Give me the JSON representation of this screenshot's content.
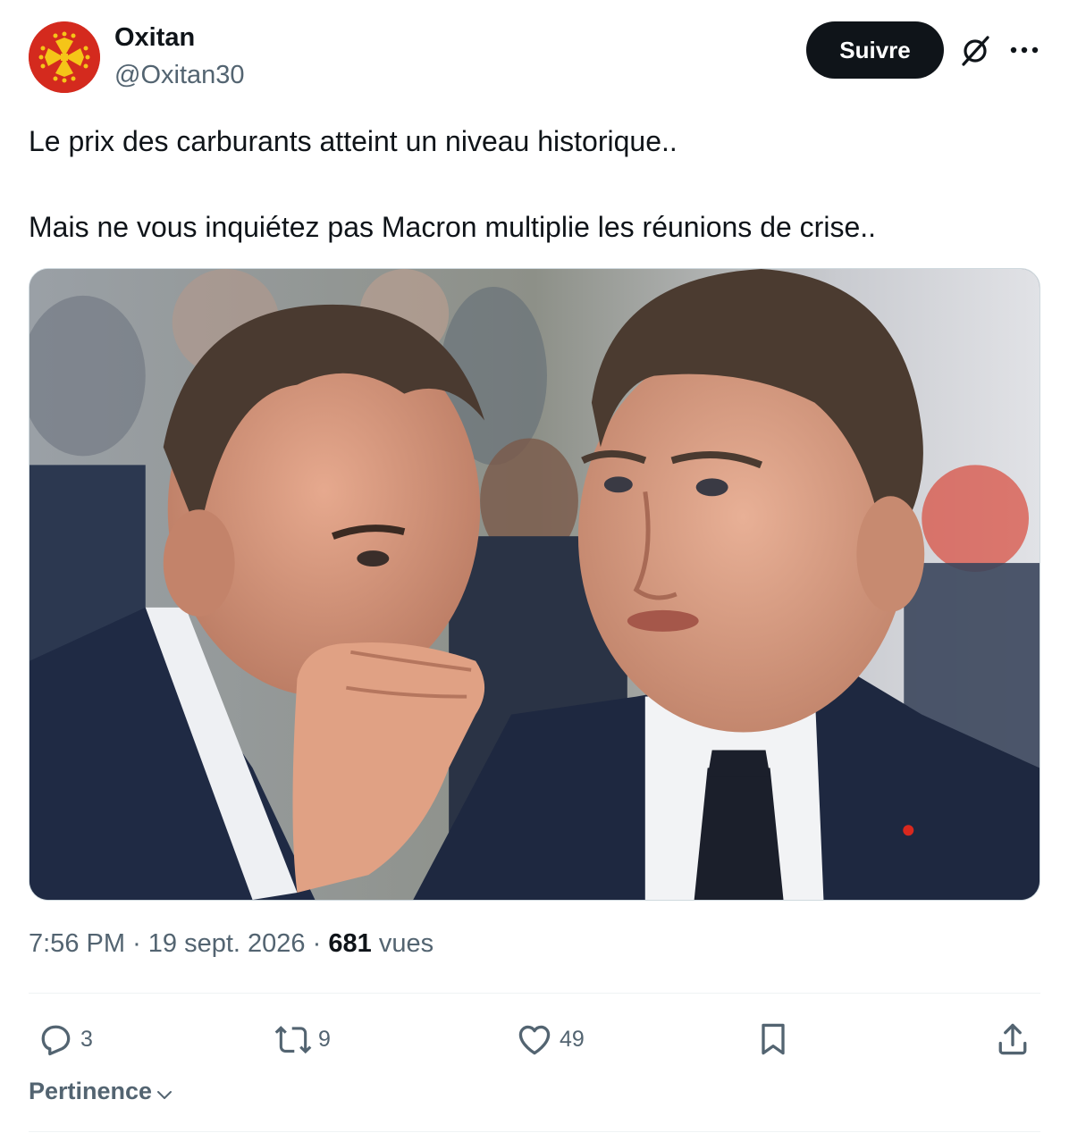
{
  "author": {
    "name": "Oxitan",
    "handle": "@Oxitan30",
    "avatar_color": "#d42a1e",
    "avatar_icon": "occitan-cross-icon"
  },
  "follow_label": "Suivre",
  "tweet": {
    "lines": [
      "Le prix des carburants atteint un niveau historique..",
      "Mais ne vous inquiétez pas Macron multiplie les réunions de crise.."
    ]
  },
  "media": {
    "icon": "photo"
  },
  "meta": {
    "time": "7:56 PM",
    "separator": "·",
    "date": "19 sept. 2026",
    "views_count": "681",
    "views_label": "vues"
  },
  "actions": {
    "replies": "3",
    "reposts": "9",
    "likes": "49"
  },
  "sort_label": "Pertinence",
  "colors": {
    "text": "#0f1419",
    "secondary": "#536471",
    "button_bg": "#0f1419",
    "divider": "#eff3f4"
  }
}
